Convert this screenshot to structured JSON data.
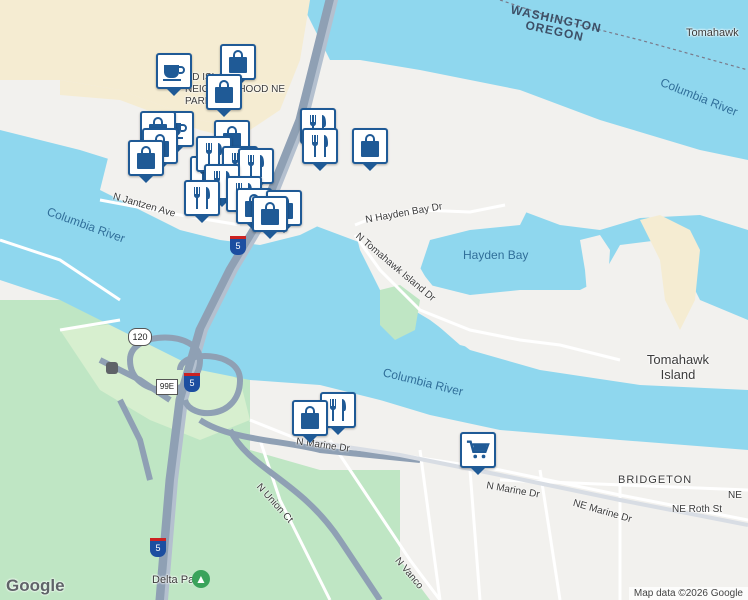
{
  "map": {
    "labels": {
      "washington": "WASHINGTON",
      "oregon": "OREGON",
      "tomahawk_top": "Tomahawk",
      "columbia_river_ne": "Columbia River",
      "columbia_river_w": "Columbia River",
      "columbia_river_s": "Columbia River",
      "hayden_bay": "Hayden Bay",
      "hayden_bay_dr": "N Hayden Bay Dr",
      "tomahawk_island_dr": "N Tomahawk Island Dr",
      "jantzen_ave": "N Jantzen Ave",
      "tomahawk_island": "Tomahawk Island",
      "marine_dr_1": "N Marine Dr",
      "marine_dr_2": "N Marine Dr",
      "ne_marine_dr": "NE Marine Dr",
      "bridgeton": "BRIDGETON",
      "ne_roth_st": "NE Roth St",
      "ne_trunc": "NE",
      "union_ct": "N Union Ct",
      "vancouver": "N Vanco",
      "delta_park": "Delta Park",
      "island_neighborhood": "ND ISLAND NEIGHBORHOOD NE PARK"
    },
    "shields": {
      "i5_a": "5",
      "i5_b": "5",
      "i5_c": "5",
      "or99e": "99E",
      "or120": "120"
    },
    "pins": [
      {
        "type": "cafe",
        "icon": "coffee-cup-icon"
      },
      {
        "type": "shopping",
        "icon": "shopping-bag-icon"
      },
      {
        "type": "shopping",
        "icon": "shopping-bag-icon"
      },
      {
        "type": "cafe",
        "icon": "coffee-cup-icon"
      },
      {
        "type": "shopping",
        "icon": "shopping-bag-icon"
      },
      {
        "type": "shopping",
        "icon": "shopping-bag-icon"
      },
      {
        "type": "shopping",
        "icon": "shopping-bag-icon"
      },
      {
        "type": "restaurant",
        "icon": "fork-knife-icon"
      },
      {
        "type": "restaurant",
        "icon": "fork-knife-icon"
      },
      {
        "type": "shopping",
        "icon": "shopping-bag-icon"
      },
      {
        "type": "restaurant",
        "icon": "fork-knife-icon"
      },
      {
        "type": "restaurant",
        "icon": "fork-knife-icon"
      },
      {
        "type": "restaurant",
        "icon": "fork-knife-icon"
      },
      {
        "type": "restaurant",
        "icon": "fork-knife-icon"
      },
      {
        "type": "restaurant",
        "icon": "fork-knife-icon"
      },
      {
        "type": "shopping",
        "icon": "shopping-bag-icon"
      },
      {
        "type": "restaurant",
        "icon": "fork-knife-icon"
      },
      {
        "type": "restaurant",
        "icon": "fork-knife-icon"
      },
      {
        "type": "shopping",
        "icon": "shopping-bag-icon"
      },
      {
        "type": "shopping",
        "icon": "shopping-bag-icon"
      },
      {
        "type": "shopping",
        "icon": "shopping-bag-icon"
      },
      {
        "type": "restaurant",
        "icon": "fork-knife-icon"
      },
      {
        "type": "shopping",
        "icon": "shopping-bag-icon"
      },
      {
        "type": "grocery",
        "icon": "shopping-cart-icon"
      }
    ],
    "attribution": "Map data ©2026 Google",
    "logo": "Google",
    "colors": {
      "water": "#8fd7ee",
      "land": "#f2f1ee",
      "park": "#bfe6c4",
      "highway": "#8fa0b4",
      "pin_border": "#1f5a96",
      "sand": "#f5ecd2"
    }
  }
}
